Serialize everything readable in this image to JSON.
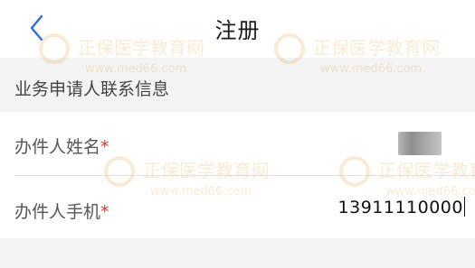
{
  "header": {
    "title": "注册"
  },
  "section": {
    "title": "业务申请人联系信息"
  },
  "form": {
    "name_label": "办件人姓名",
    "name_required_mark": "*",
    "phone_label": "办件人手机",
    "phone_required_mark": "*",
    "phone_value": "13911110000"
  },
  "watermark": {
    "brand": "正保医学教育网",
    "url": "www.med66.com"
  },
  "colors": {
    "accent": "#2f6fd6",
    "required": "#e03030",
    "watermark": "#e8a640"
  },
  "icons": {
    "back": "chevron-left-icon"
  }
}
